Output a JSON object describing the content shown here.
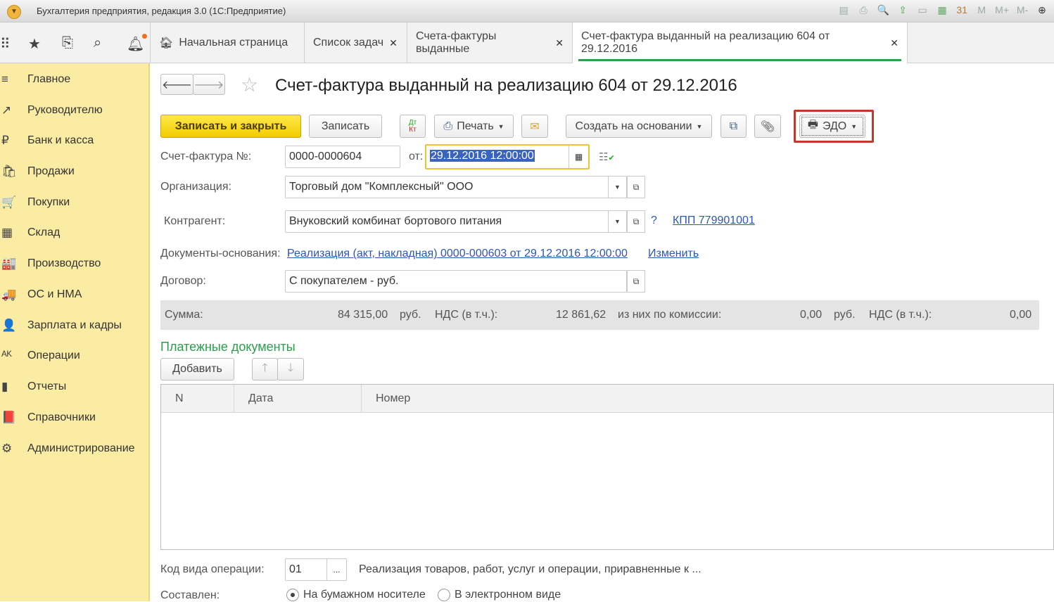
{
  "window": {
    "title": "Бухгалтерия предприятия, редакция 3.0  (1С:Предприятие)",
    "toolbar_icons": [
      "save-icon",
      "print-icon",
      "preview-icon",
      "upload-icon",
      "scanner-icon",
      "calculator-icon",
      "calendar-icon",
      "M",
      "M+",
      "M-",
      "zoom-icon"
    ]
  },
  "tabs": [
    {
      "label": "Начальная страница"
    },
    {
      "label": "Список задач"
    },
    {
      "label": "Счета-фактуры выданные"
    },
    {
      "label": "Счет-фактура выданный на реализацию 604 от 29.12.2016"
    }
  ],
  "sidebar": {
    "items": [
      {
        "label": "Главное",
        "icon": "≡"
      },
      {
        "label": "Руководителю",
        "icon": "↗"
      },
      {
        "label": "Банк и касса",
        "icon": "₽"
      },
      {
        "label": "Продажи",
        "icon": "🛍"
      },
      {
        "label": "Покупки",
        "icon": "🛒"
      },
      {
        "label": "Склад",
        "icon": "▦"
      },
      {
        "label": "Производство",
        "icon": "🏭"
      },
      {
        "label": "ОС и НМА",
        "icon": "🚚"
      },
      {
        "label": "Зарплата и кадры",
        "icon": "👤"
      },
      {
        "label": "Операции",
        "icon": "ᴬᴷ"
      },
      {
        "label": "Отчеты",
        "icon": "▮"
      },
      {
        "label": "Справочники",
        "icon": "📕"
      },
      {
        "label": "Администрирование",
        "icon": "⚙"
      }
    ]
  },
  "form": {
    "title": "Счет-фактура выданный на реализацию 604 от 29.12.2016",
    "buttons": {
      "save_close": "Записать и закрыть",
      "save": "Записать",
      "dtkt_top": "Дт",
      "dtkt_bottom": "Кт",
      "print": "Печать",
      "create_based": "Создать на основании",
      "edo": "ЭДО"
    },
    "invoice_no_label": "Счет-фактура №:",
    "invoice_no": "0000-0000604",
    "date_label": "от:",
    "date": "29.12.2016 12:00:00",
    "org_label": "Организация:",
    "org": "Торговый дом \"Комплексный\" ООО",
    "contractor_label": "Контрагент:",
    "contractor": "Внуковский комбинат бортового питания",
    "help": "?",
    "kpp": "КПП 779901001",
    "base_docs_label": "Документы-основания:",
    "base_doc": "Реализация (акт, накладная) 0000-000603 от 29.12.2016 12:00:00",
    "change": "Изменить",
    "contract_label": "Договор:",
    "contract": "С покупателем - руб.",
    "sum": {
      "label": "Сумма:",
      "amount": "84 315,00",
      "cur1": "руб.",
      "vat_label": "НДС (в т.ч.):",
      "vat": "12 861,62",
      "commission_label": "из них по комиссии:",
      "commission": "0,00",
      "cur2": "руб.",
      "vat2_label": "НДС (в т.ч.):",
      "vat2": "0,00"
    },
    "payments_title": "Платежные документы",
    "add": "Добавить",
    "columns": [
      "N",
      "Дата",
      "Номер"
    ],
    "op_code_label": "Код вида операции:",
    "op_code": "01",
    "op_code_desc": "Реализация товаров, работ, услуг и операции, приравненные к ...",
    "composed_label": "Составлен:",
    "composed_options": [
      "На бумажном носителе",
      "В электронном виде"
    ],
    "composed_selected": 0
  }
}
